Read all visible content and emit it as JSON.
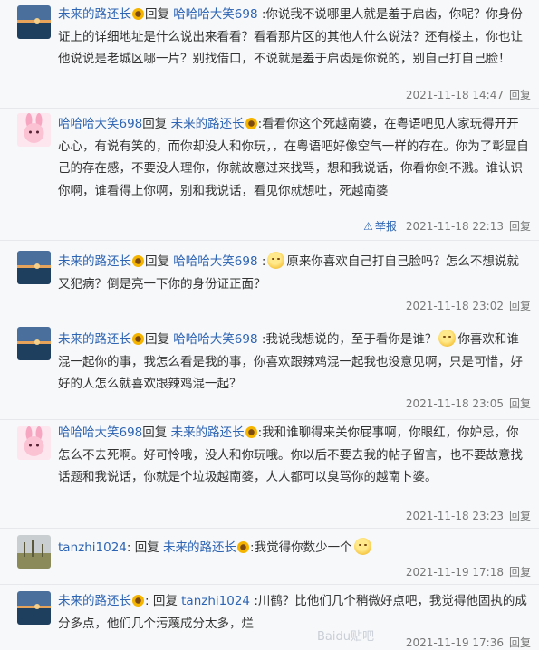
{
  "comments": [
    {
      "user": "未来的路还长",
      "reply_word": "回复",
      "target": "哈哈哈大笑698",
      "text": ":你说我不说哪里人就是羞于启齿，你呢？你身份证上的详细地址是什么说出来看看？看看那片区的其他人什么说法？还有楼主，你也让他说说是老城区哪一片？别找借口，不说就是羞于启齿是你说的，别自己打自己脸！",
      "time": "2021-11-18 14:47",
      "reply_label": "回复"
    },
    {
      "user": "哈哈哈大笑698",
      "reply_word": "回复",
      "target": "未来的路还长",
      "text": ":看看你这个死越南婆，在粤语吧见人家玩得开开心心，有说有笑的，而你却没人和你玩，，在粤语吧好像空气一样的存在。你为了彰显自己的存在感，不要没人理你，你就故意过来找骂，想和我说话，你看你剑不溅。谁认识你啊，谁看得上你啊，别和我说话，看见你就想吐，死越南婆",
      "report_label": "举报",
      "time": "2021-11-18 22:13",
      "reply_label": "回复"
    },
    {
      "user": "未来的路还长",
      "reply_word": "回复",
      "target": "哈哈哈大笑698",
      "text": "原来你喜欢自己打自己脸吗？怎么不想说就又犯病？倒是亮一下你的身份证正面？",
      "time": "2021-11-18 23:02",
      "reply_label": "回复"
    },
    {
      "user": "未来的路还长",
      "reply_word": "回复",
      "target": "哈哈哈大笑698",
      "text_a": ":我说我想说的，至于看你是谁？",
      "text_b": "你喜欢和谁混一起你的事，我怎么看是我的事，你喜欢跟辣鸡混一起我也没意见啊，只是可惜，好好的人怎么就喜欢跟辣鸡混一起？",
      "time": "2021-11-18 23:05",
      "reply_label": "回复"
    },
    {
      "user": "哈哈哈大笑698",
      "reply_word": "回复",
      "target": "未来的路还长",
      "text": ":我和谁聊得来关你屁事啊，你眼红，你妒忌，你怎么不去死啊。好可怜哦，没人和你玩哦。你以后不要去我的帖子留言，也不要故意找话题和我说话，你就是个垃圾越南婆，人人都可以臭骂你的越南卜婆。",
      "time": "2021-11-18 23:23",
      "reply_label": "回复"
    },
    {
      "user": "tanzhi1024",
      "reply_word": "回复",
      "target": "未来的路还长",
      "text": ":我觉得你数少一个",
      "time": "2021-11-19 17:18",
      "reply_label": "回复"
    },
    {
      "user": "未来的路还长",
      "reply_word": "回复",
      "target": "tanzhi1024",
      "text": ":川鹤？比他们几个稍微好点吧，我觉得他固执的成分多点，他们几个污蔑成分太多，烂",
      "time": "2021-11-19 17:36",
      "reply_label": "回复"
    }
  ],
  "watermark": "Baidu贴吧",
  "colors": {
    "link": "#2d64b3",
    "text": "#333333",
    "meta": "#777777",
    "background": "#f7f8fa"
  }
}
